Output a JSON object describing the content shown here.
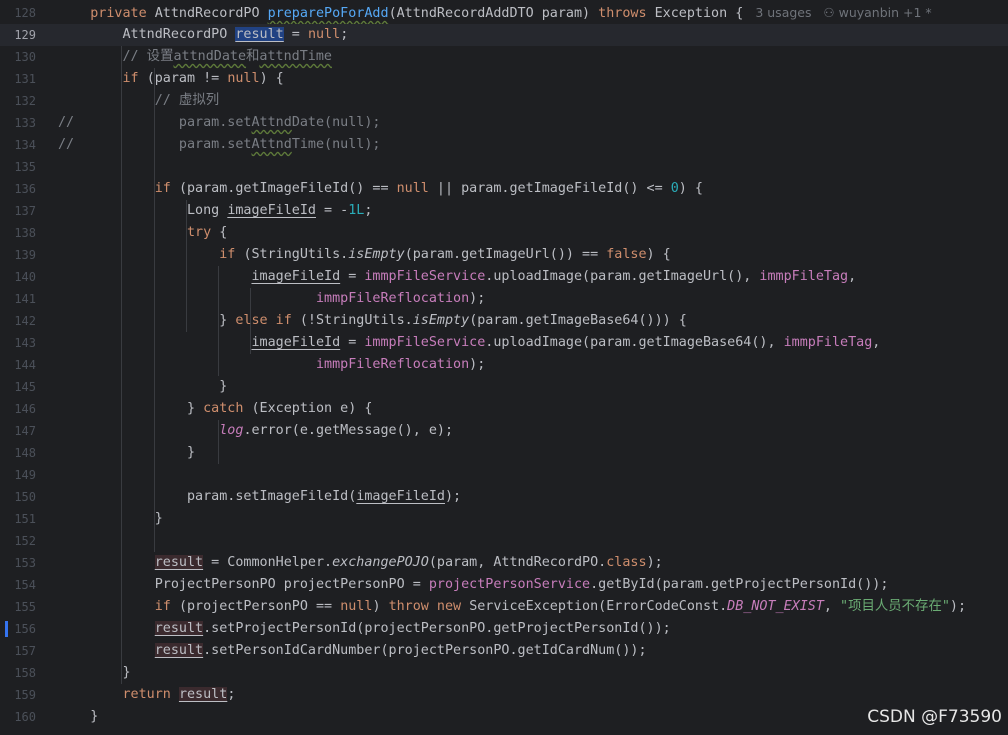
{
  "editor": {
    "current_line": 129,
    "lines": [
      {
        "num": "128",
        "tokens": [
          {
            "t": "    "
          },
          {
            "t": "private ",
            "c": "kw"
          },
          {
            "t": "AttndRecordPO "
          },
          {
            "t": "preparePoForAdd",
            "c": "fn wv"
          },
          {
            "t": "(AttndRecordAddDTO param) "
          },
          {
            "t": "throws ",
            "c": "kw"
          },
          {
            "t": "Exception { "
          },
          {
            "t": " 3 usages   ⚇ wuyanbin +1 *",
            "c": "hint"
          }
        ]
      },
      {
        "num": "129",
        "tokens": [
          {
            "t": "        AttndRecordPO "
          },
          {
            "t": "result",
            "c": "ul hl"
          },
          {
            "t": " = "
          },
          {
            "t": "null",
            "c": "kw"
          },
          {
            "t": ";"
          }
        ]
      },
      {
        "num": "130",
        "tokens": [
          {
            "t": "        "
          },
          {
            "t": "// 设置",
            "c": "cm"
          },
          {
            "t": "attndDate",
            "c": "cm wv"
          },
          {
            "t": "和",
            "c": "cm"
          },
          {
            "t": "attndTime",
            "c": "cm wv"
          }
        ]
      },
      {
        "num": "131",
        "tokens": [
          {
            "t": "        "
          },
          {
            "t": "if ",
            "c": "kw"
          },
          {
            "t": "(param != "
          },
          {
            "t": "null",
            "c": "kw"
          },
          {
            "t": ") {"
          }
        ]
      },
      {
        "num": "132",
        "tokens": [
          {
            "t": "            "
          },
          {
            "t": "// 虚拟列",
            "c": "cm"
          }
        ]
      },
      {
        "num": "133",
        "tokens": [
          {
            "t": "//",
            "c": "cm"
          },
          {
            "t": "             param.set",
            "c": "cm"
          },
          {
            "t": "Attnd",
            "c": "cm wv"
          },
          {
            "t": "Date(null);",
            "c": "cm"
          }
        ]
      },
      {
        "num": "134",
        "tokens": [
          {
            "t": "//",
            "c": "cm"
          },
          {
            "t": "             param.set",
            "c": "cm"
          },
          {
            "t": "Attnd",
            "c": "cm wv"
          },
          {
            "t": "Time(null);",
            "c": "cm"
          }
        ]
      },
      {
        "num": "135",
        "tokens": []
      },
      {
        "num": "136",
        "tokens": [
          {
            "t": "            "
          },
          {
            "t": "if ",
            "c": "kw"
          },
          {
            "t": "(param.getImageFileId() == "
          },
          {
            "t": "null",
            "c": "kw"
          },
          {
            "t": " || param.getImageFileId() <= "
          },
          {
            "t": "0",
            "c": "num"
          },
          {
            "t": ") {"
          }
        ]
      },
      {
        "num": "137",
        "tokens": [
          {
            "t": "                Long "
          },
          {
            "t": "imageFileId",
            "c": "ul"
          },
          {
            "t": " = -"
          },
          {
            "t": "1L",
            "c": "num"
          },
          {
            "t": ";"
          }
        ]
      },
      {
        "num": "138",
        "tokens": [
          {
            "t": "                "
          },
          {
            "t": "try ",
            "c": "kw"
          },
          {
            "t": "{"
          }
        ]
      },
      {
        "num": "139",
        "tokens": [
          {
            "t": "                    "
          },
          {
            "t": "if ",
            "c": "kw"
          },
          {
            "t": "(StringUtils."
          },
          {
            "t": "isEmpty",
            "c": "stat"
          },
          {
            "t": "(param.getImageUrl()) == "
          },
          {
            "t": "false",
            "c": "kw"
          },
          {
            "t": ") {"
          }
        ]
      },
      {
        "num": "140",
        "tokens": [
          {
            "t": "                        "
          },
          {
            "t": "imageFileId",
            "c": "ul"
          },
          {
            "t": " = "
          },
          {
            "t": "immpFileService",
            "c": "fld"
          },
          {
            "t": ".uploadImage(param.getImageUrl(), "
          },
          {
            "t": "immpFileTag",
            "c": "fld"
          },
          {
            "t": ","
          }
        ]
      },
      {
        "num": "141",
        "tokens": [
          {
            "t": "                                "
          },
          {
            "t": "immpFileReflocation",
            "c": "fld"
          },
          {
            "t": ");"
          }
        ]
      },
      {
        "num": "142",
        "tokens": [
          {
            "t": "                    } "
          },
          {
            "t": "else if ",
            "c": "kw"
          },
          {
            "t": "(!StringUtils."
          },
          {
            "t": "isEmpty",
            "c": "stat"
          },
          {
            "t": "(param.getImageBase64())) {"
          }
        ]
      },
      {
        "num": "143",
        "tokens": [
          {
            "t": "                        "
          },
          {
            "t": "imageFileId",
            "c": "ul"
          },
          {
            "t": " = "
          },
          {
            "t": "immpFileService",
            "c": "fld"
          },
          {
            "t": ".uploadImage(param.getImageBase64(), "
          },
          {
            "t": "immpFileTag",
            "c": "fld"
          },
          {
            "t": ","
          }
        ]
      },
      {
        "num": "144",
        "tokens": [
          {
            "t": "                                "
          },
          {
            "t": "immpFileReflocation",
            "c": "fld"
          },
          {
            "t": ");"
          }
        ]
      },
      {
        "num": "145",
        "tokens": [
          {
            "t": "                    }"
          }
        ]
      },
      {
        "num": "146",
        "tokens": [
          {
            "t": "                } "
          },
          {
            "t": "catch ",
            "c": "kw"
          },
          {
            "t": "(Exception e) {"
          }
        ]
      },
      {
        "num": "147",
        "tokens": [
          {
            "t": "                    "
          },
          {
            "t": "log",
            "c": "statfld"
          },
          {
            "t": ".error(e.getMessage(), e);"
          }
        ]
      },
      {
        "num": "148",
        "tokens": [
          {
            "t": "                }"
          }
        ]
      },
      {
        "num": "149",
        "tokens": []
      },
      {
        "num": "150",
        "tokens": [
          {
            "t": "                param.setImageFileId("
          },
          {
            "t": "imageFileId",
            "c": "ul"
          },
          {
            "t": ");"
          }
        ]
      },
      {
        "num": "151",
        "tokens": [
          {
            "t": "            }"
          }
        ]
      },
      {
        "num": "152",
        "tokens": []
      },
      {
        "num": "153",
        "tokens": [
          {
            "t": "            "
          },
          {
            "t": "result",
            "c": "ul rd"
          },
          {
            "t": " = CommonHelper."
          },
          {
            "t": "exchangePOJO",
            "c": "stat"
          },
          {
            "t": "(param, AttndRecordPO."
          },
          {
            "t": "class",
            "c": "kw"
          },
          {
            "t": ");"
          }
        ]
      },
      {
        "num": "154",
        "tokens": [
          {
            "t": "            ProjectPersonPO projectPersonPO = "
          },
          {
            "t": "projectPersonService",
            "c": "fld"
          },
          {
            "t": ".getById(param.getProjectPersonId());"
          }
        ]
      },
      {
        "num": "155",
        "tokens": [
          {
            "t": "            "
          },
          {
            "t": "if ",
            "c": "kw"
          },
          {
            "t": "(projectPersonPO == "
          },
          {
            "t": "null",
            "c": "kw"
          },
          {
            "t": ") "
          },
          {
            "t": "throw new ",
            "c": "kw"
          },
          {
            "t": "ServiceException(ErrorCodeConst."
          },
          {
            "t": "DB_NOT_EXIST",
            "c": "statfld"
          },
          {
            "t": ", "
          },
          {
            "t": "\"项目人员不存在\"",
            "c": "str"
          },
          {
            "t": ");"
          }
        ]
      },
      {
        "num": "156",
        "tokens": [
          {
            "t": "            "
          },
          {
            "t": "result",
            "c": "ul rd"
          },
          {
            "t": ".setProjectPersonId(projectPersonPO.getProjectPersonId());"
          }
        ]
      },
      {
        "num": "157",
        "tokens": [
          {
            "t": "            "
          },
          {
            "t": "result",
            "c": "ul rd"
          },
          {
            "t": ".setPersonIdCardNumber(projectPersonPO.getIdCardNum());"
          }
        ]
      },
      {
        "num": "158",
        "tokens": [
          {
            "t": "        }"
          }
        ]
      },
      {
        "num": "159",
        "tokens": [
          {
            "t": "        "
          },
          {
            "t": "return ",
            "c": "kw"
          },
          {
            "t": "result",
            "c": "ul rd"
          },
          {
            "t": ";"
          }
        ]
      },
      {
        "num": "160",
        "tokens": [
          {
            "t": "    }"
          }
        ]
      }
    ]
  },
  "watermark": "CSDN @F73590"
}
